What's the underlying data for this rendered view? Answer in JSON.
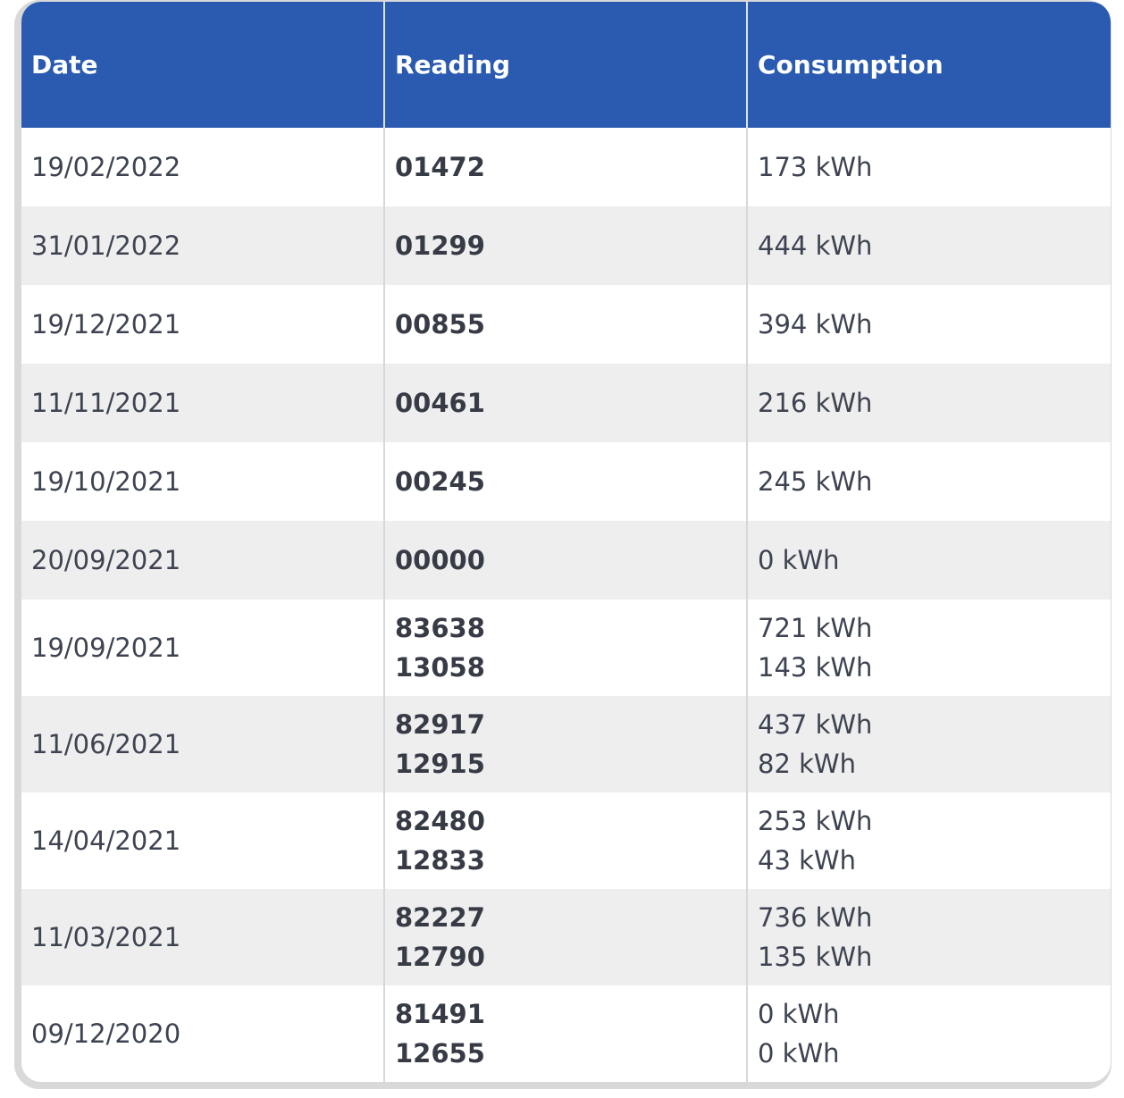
{
  "table": {
    "headers": {
      "date": "Date",
      "reading": "Reading",
      "consumption": "Consumption"
    },
    "rows": [
      {
        "date": "19/02/2022",
        "readings": [
          "01472"
        ],
        "consumption": [
          "173 kWh"
        ]
      },
      {
        "date": "31/01/2022",
        "readings": [
          "01299"
        ],
        "consumption": [
          "444 kWh"
        ]
      },
      {
        "date": "19/12/2021",
        "readings": [
          "00855"
        ],
        "consumption": [
          "394 kWh"
        ]
      },
      {
        "date": "11/11/2021",
        "readings": [
          "00461"
        ],
        "consumption": [
          "216 kWh"
        ]
      },
      {
        "date": "19/10/2021",
        "readings": [
          "00245"
        ],
        "consumption": [
          "245 kWh"
        ]
      },
      {
        "date": "20/09/2021",
        "readings": [
          "00000"
        ],
        "consumption": [
          "0 kWh"
        ]
      },
      {
        "date": "19/09/2021",
        "readings": [
          "83638",
          "13058"
        ],
        "consumption": [
          "721 kWh",
          "143 kWh"
        ]
      },
      {
        "date": "11/06/2021",
        "readings": [
          "82917",
          "12915"
        ],
        "consumption": [
          "437 kWh",
          "82 kWh"
        ]
      },
      {
        "date": "14/04/2021",
        "readings": [
          "82480",
          "12833"
        ],
        "consumption": [
          "253 kWh",
          "43 kWh"
        ]
      },
      {
        "date": "11/03/2021",
        "readings": [
          "82227",
          "12790"
        ],
        "consumption": [
          "736 kWh",
          "135 kWh"
        ]
      },
      {
        "date": "09/12/2020",
        "readings": [
          "81491",
          "12655"
        ],
        "consumption": [
          "0 kWh",
          "0 kWh"
        ]
      }
    ]
  },
  "colors": {
    "header_bg": "#2a5bb0",
    "header_text": "#ffffff",
    "row_alt_bg": "#eeeeee",
    "text": "#3d4350"
  }
}
